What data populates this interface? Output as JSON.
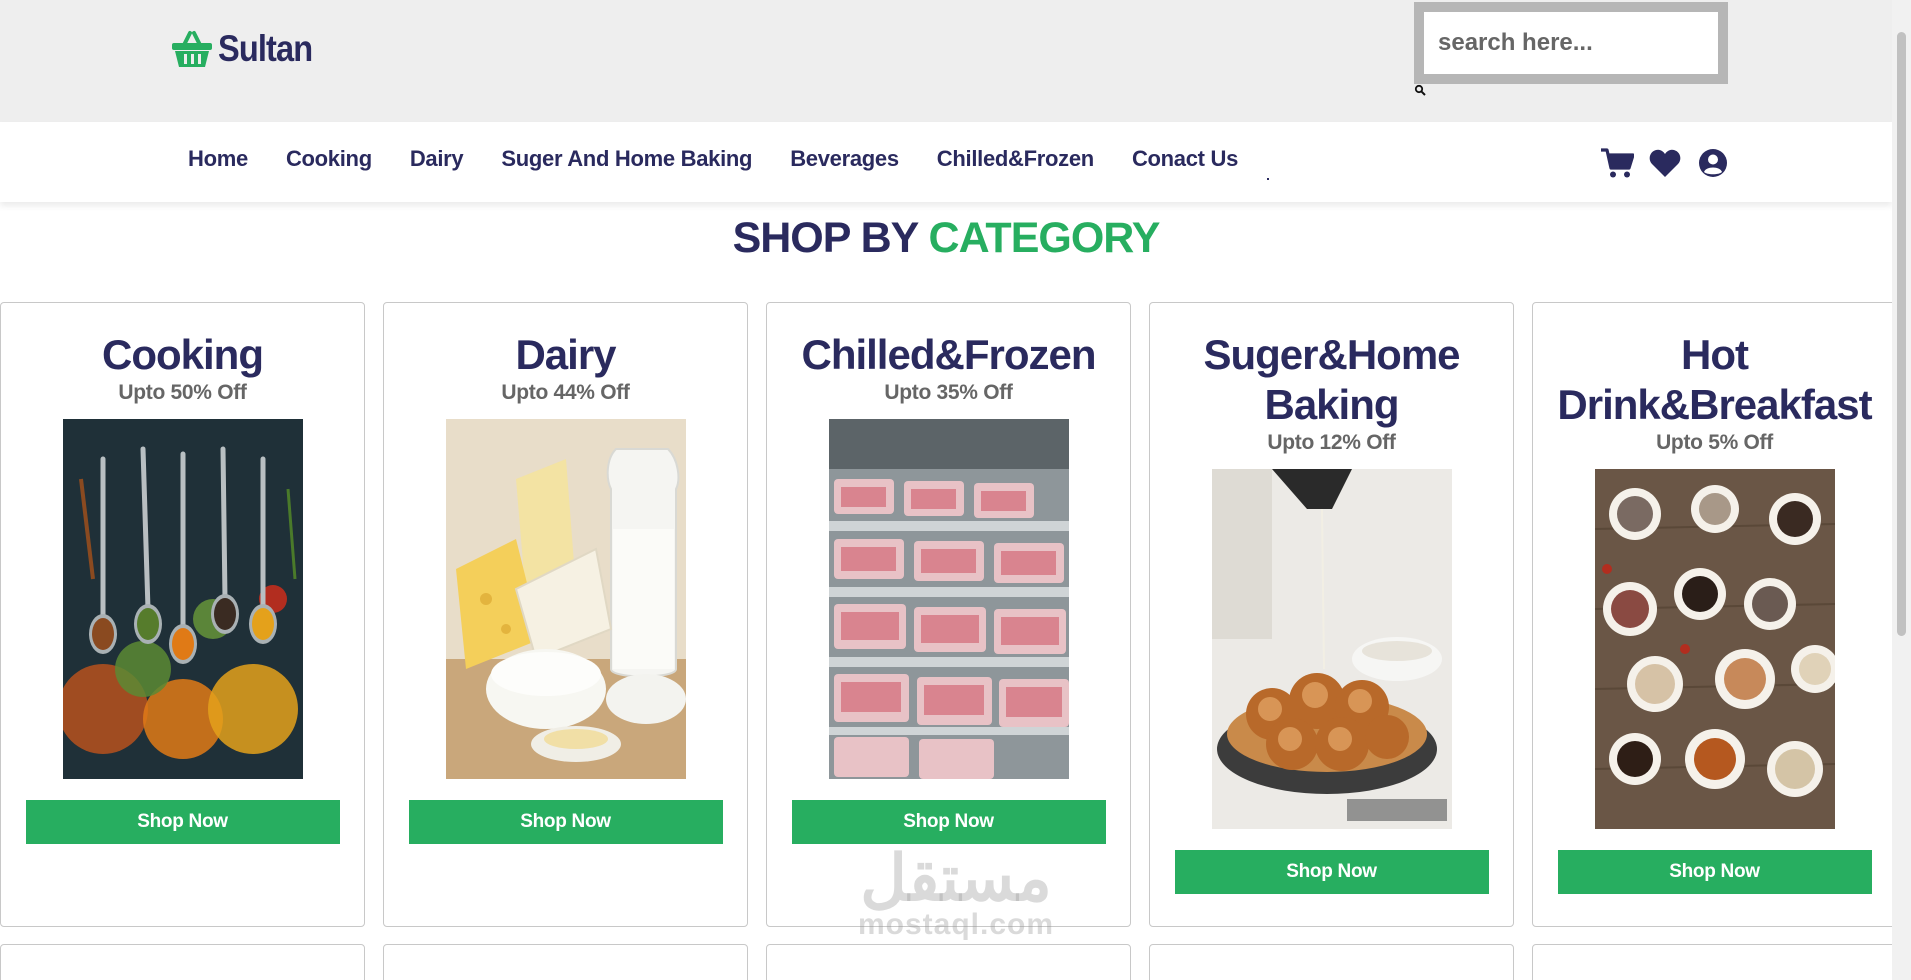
{
  "header": {
    "brand": "Sultan",
    "search_placeholder": "search here..."
  },
  "nav": {
    "links": [
      "Home",
      "Cooking",
      "Dairy",
      "Suger And Home Baking",
      "Beverages",
      "Chilled&Frozen",
      "Conact Us"
    ]
  },
  "section": {
    "title_part1": "SHOP BY",
    "title_part2": "CATEGORY"
  },
  "categories": [
    {
      "title": "Cooking",
      "offer": "Upto 50% Off",
      "button": "Shop Now"
    },
    {
      "title": "Dairy",
      "offer": "Upto 44% Off",
      "button": "Shop Now"
    },
    {
      "title": "Chilled&Frozen",
      "offer": "Upto 35% Off",
      "button": "Shop Now"
    },
    {
      "title": "Suger&Home Baking",
      "offer": "Upto 12% Off",
      "button": "Shop Now"
    },
    {
      "title": "Hot Drink&Breakfast",
      "offer": "Upto 5% Off",
      "button": "Shop Now"
    }
  ],
  "watermark": {
    "arabic": "مستقل",
    "latin": "mostaql.com"
  },
  "colors": {
    "brand_navy": "#2a2a5e",
    "accent_green": "#27ae60",
    "header_bg": "#eeeeee"
  },
  "icons": [
    "basket-icon",
    "search-icon",
    "cart-icon",
    "heart-icon",
    "user-icon"
  ]
}
